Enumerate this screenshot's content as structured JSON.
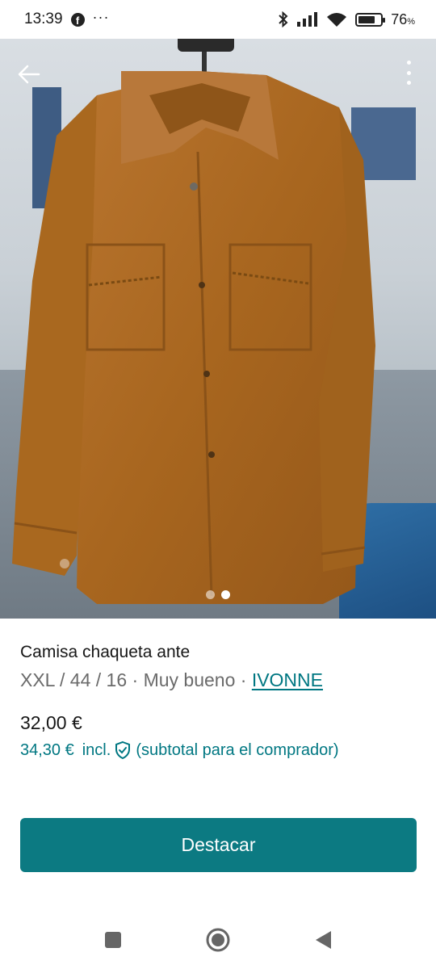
{
  "status_bar": {
    "time": "13:39",
    "notification_icon": "facebook-icon",
    "more_dots": "···",
    "battery_percent": "76",
    "battery_percent_sign": "%",
    "battery_level": 0.76
  },
  "photo": {
    "description_icons": [
      "back-arrow-icon",
      "more-vertical-icon"
    ],
    "page_count": 2,
    "active_page": 1
  },
  "item": {
    "title": "Camisa chaqueta ante",
    "size_condition": "XXL / 44 / 16 · Muy bueno · ",
    "seller": "IVONNE",
    "price": "32,00 €",
    "buyer_price": "34,30 €",
    "buyer_price_incl": "incl.",
    "buyer_note": "(subtotal para el comprador)"
  },
  "actions": {
    "highlight_label": "Destacar"
  },
  "colors": {
    "accent": "#007782",
    "button": "#0c7a82"
  }
}
